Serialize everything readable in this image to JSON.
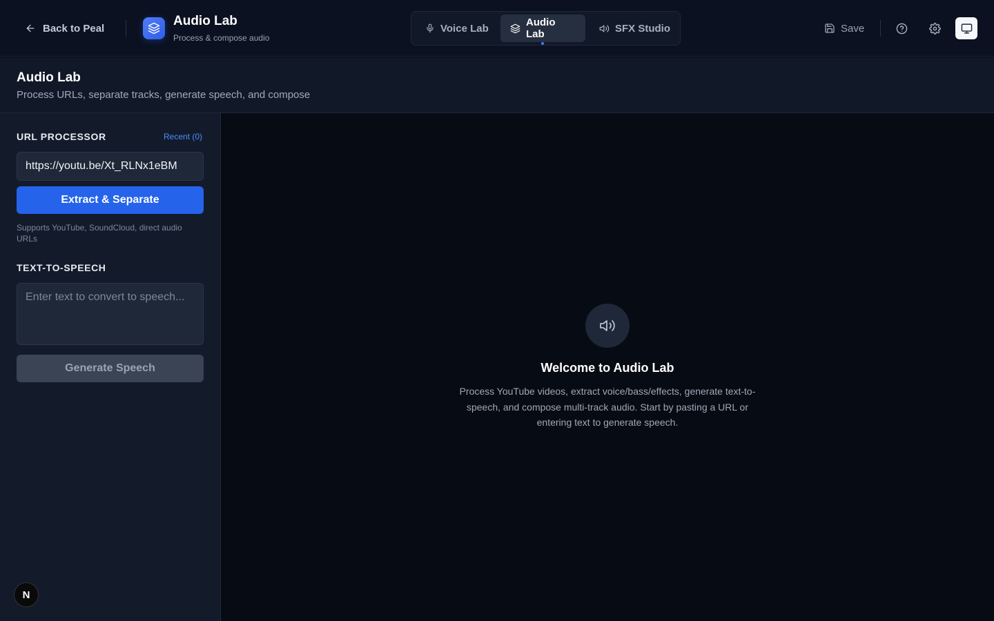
{
  "topbar": {
    "back_label": "Back to Peal",
    "app_title": "Audio Lab",
    "app_subtitle": "Process & compose audio",
    "tabs": [
      {
        "label": "Voice Lab",
        "icon": "mic-icon",
        "active": false
      },
      {
        "label": "Audio Lab",
        "icon": "layers-icon",
        "active": true
      },
      {
        "label": "SFX Studio",
        "icon": "speaker-icon",
        "active": false
      }
    ],
    "save_label": "Save"
  },
  "header": {
    "title": "Audio Lab",
    "subtitle": "Process URLs, separate tracks, generate speech, and compose"
  },
  "sidebar": {
    "url_section_title": "URL PROCESSOR",
    "recent_label": "Recent (0)",
    "url_value": "https://youtu.be/Xt_RLNx1eBM",
    "extract_button": "Extract & Separate",
    "supports_hint": "Supports YouTube, SoundCloud, direct audio URLs",
    "tts_section_title": "TEXT-TO-SPEECH",
    "tts_placeholder": "Enter text to convert to speech...",
    "generate_button": "Generate Speech",
    "badge_letter": "N"
  },
  "main": {
    "welcome_title": "Welcome to Audio Lab",
    "welcome_text": "Process YouTube videos, extract voice/bass/effects, generate text-to-speech, and compose multi-track audio. Start by pasting a URL or entering text to generate speech."
  },
  "colors": {
    "accent": "#2563eb",
    "link": "#4d8dff",
    "background": "#070b14",
    "sidebar": "#131b2b"
  }
}
